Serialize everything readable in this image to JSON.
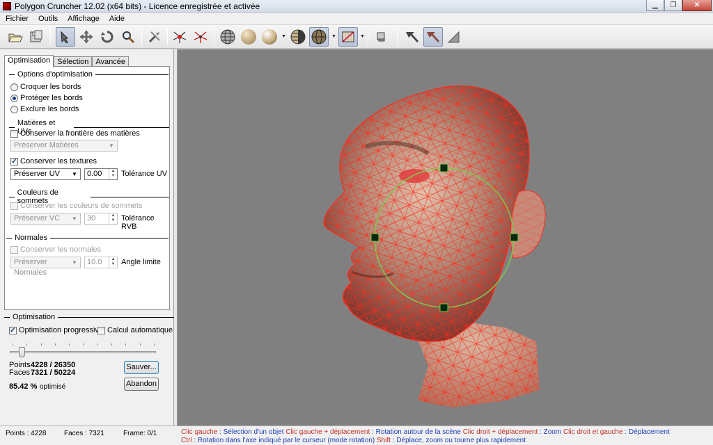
{
  "window": {
    "title": "Polygon Cruncher 12.02 (x64 bits) - Licence enregistrée et activée"
  },
  "menu": [
    "Fichier",
    "Outils",
    "Affichage",
    "Aide"
  ],
  "toolbar": {
    "buttons": [
      "open-icon",
      "save-icon",
      "select-icon",
      "move-icon",
      "rotate-icon",
      "zoom-icon",
      "tools-icon",
      "vertex-view-icon",
      "edge-view-icon",
      "wireframe-sphere-icon",
      "flat-sphere-icon",
      "smooth-sphere-icon",
      "half-sphere-icon",
      "shaded-sphere-icon",
      "texture-icon",
      "material-icon",
      "arrow-view-1-icon",
      "arrow-view-2-icon",
      "arrow-view-3-icon"
    ]
  },
  "tabs": [
    "Optimisation",
    "Sélection",
    "Avancée"
  ],
  "groups": {
    "options": {
      "title": "Options d'optimisation",
      "radios": [
        "Croquer les bords",
        "Protéger les bords",
        "Exclure les bords"
      ],
      "selected": 1
    },
    "materials": {
      "title": "Matières et UVs",
      "check_border": "Conserver la frontière des matières",
      "combo_materials": "Préserver Matières",
      "check_textures": "Conserver les textures",
      "combo_uv": "Préserver UV",
      "uv_value": "0.00",
      "uv_label": "Tolérance UV"
    },
    "vertex_colors": {
      "title": "Couleurs de sommets",
      "check": "Conserver les couleurs de sommets",
      "combo": "Préserver VC",
      "value": "30",
      "label": "Tolérance RVB"
    },
    "normals": {
      "title": "Normales",
      "check": "Conserver les normales",
      "combo": "Préserver Normales",
      "value": "10.0",
      "label": "Angle limite"
    }
  },
  "optimisation": {
    "title": "Optimisation",
    "progressive_label": "Optimisation progressive",
    "progressive_checked": true,
    "auto_label": "Calcul automatique",
    "auto_checked": false,
    "slider_fraction": 0.08,
    "points_label": "Points :",
    "points_value": "4228 / 26350",
    "faces_label": "Faces :",
    "faces_value": "7321 / 50224",
    "percent_value": "85.42 %",
    "percent_label": "optimisé",
    "save_button": "Sauver...",
    "abort_button": "Abandon"
  },
  "status": {
    "points": "Points : 4228",
    "faces": "Faces : 7321",
    "frame": "Frame: 0/1",
    "help_line1": [
      {
        "k": "Clic gauche",
        "v": " : Sélection d'un objet "
      },
      {
        "k": "Clic gauche + déplacement",
        "v": " : Rotation autour de la scène "
      },
      {
        "k": "Clic droit + déplacement",
        "v": " : Zoom "
      },
      {
        "k": "Clic droit et gauche",
        "v": " : Déplacement"
      }
    ],
    "help_line2": [
      {
        "k": "Ctrl",
        "v": " : Rotation dans l'axe indiqué par le curseur (mode rotation) "
      },
      {
        "k": "Shift",
        "v": " : Déplace, zoom ou tourne plus rapidement"
      }
    ]
  },
  "colors": {
    "viewport_bg": "#808080",
    "wireframe": "#ff2a1a",
    "gizmo": "#7ec850"
  }
}
